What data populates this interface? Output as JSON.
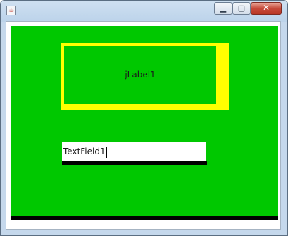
{
  "window": {
    "app_icon": "java-coffee-icon",
    "controls": {
      "minimize_glyph": "▁",
      "maximize_glyph": "▢",
      "close_glyph": "✕"
    }
  },
  "content": {
    "label": {
      "text": "jLabel1"
    },
    "text_field": {
      "value": "TextField1"
    }
  },
  "colors": {
    "panel_background": "#00c800",
    "label_border": "#ffff00",
    "bottom_bar": "#000000"
  }
}
